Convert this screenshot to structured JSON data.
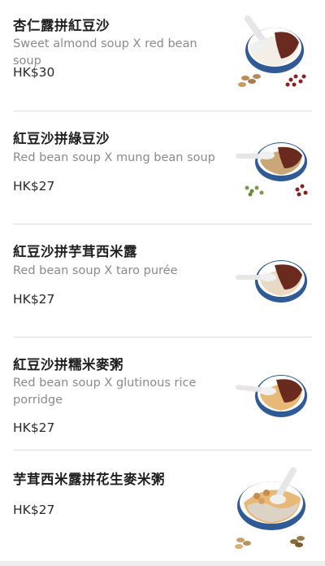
{
  "menu": {
    "items": [
      {
        "title": "杏仁露拼紅豆沙",
        "description": "Sweet almond soup X red bean soup",
        "price": "HK$30",
        "image": "almond-red-bean-bowl-icon"
      },
      {
        "title": "紅豆沙拼綠豆沙",
        "description": "Red bean soup X mung bean soup",
        "price": "HK$27",
        "image": "red-bean-mung-bean-bowl-icon"
      },
      {
        "title": "紅豆沙拼芋茸西米露",
        "description": "Red bean soup X taro purée",
        "price": "HK$27",
        "image": "red-bean-taro-bowl-icon"
      },
      {
        "title": "紅豆沙拼糯米麥粥",
        "description": "Red bean soup X glutinous rice porridge",
        "price": "HK$27",
        "image": "red-bean-rice-porridge-bowl-icon"
      },
      {
        "title": "芋茸西米露拼花生麥米粥",
        "description": "",
        "price": "HK$27",
        "image": "taro-peanut-porridge-bowl-icon"
      }
    ]
  },
  "colors": {
    "bowl_rim": "#2f5a96",
    "red_bean": "#6b2a1e",
    "almond": "#f3efe6",
    "mung": "#caa777",
    "taro": "#e8d8c4",
    "porridge": "#e8b877",
    "divider": "#dedede"
  }
}
